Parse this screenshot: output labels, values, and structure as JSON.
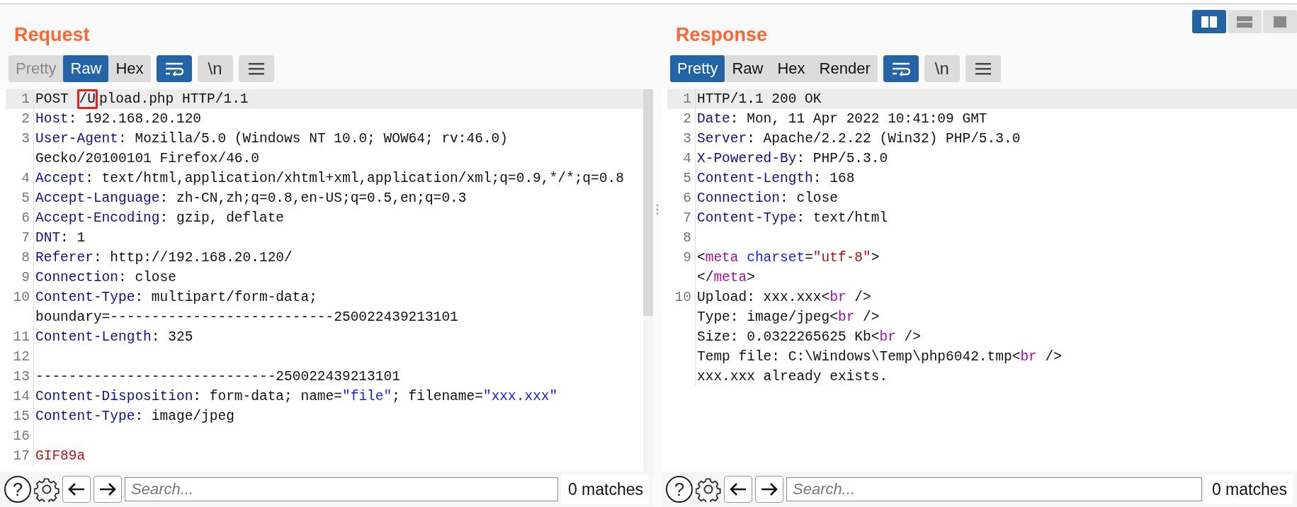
{
  "panels": [
    {
      "title": "Request",
      "tabs": [
        {
          "label": "Pretty",
          "selected": false,
          "disabled": true
        },
        {
          "label": "Raw",
          "selected": true,
          "disabled": false
        },
        {
          "label": "Hex",
          "selected": false,
          "disabled": false
        }
      ],
      "tools": [
        {
          "kind": "wrap",
          "on": true
        },
        {
          "kind": "newline",
          "label": "\\n",
          "on": false
        },
        {
          "kind": "menu",
          "on": false
        }
      ],
      "scrollbar": true,
      "lines": [
        {
          "number": "1",
          "highlighted": true,
          "rows": [
            [
              {
                "kind": "plain",
                "text": "POST "
              },
              {
                "kind": "boxed",
                "text": "/U"
              },
              {
                "kind": "plain",
                "text": "pload.php HTTP/1.1"
              }
            ]
          ]
        },
        {
          "number": "2",
          "highlighted": false,
          "rows": [
            [
              {
                "kind": "key",
                "text": "Host"
              },
              {
                "kind": "plain",
                "text": ": 192.168.20.120"
              }
            ]
          ]
        },
        {
          "number": "3",
          "highlighted": false,
          "rows": [
            [
              {
                "kind": "key",
                "text": "User-Agent"
              },
              {
                "kind": "plain",
                "text": ": Mozilla/5.0 (Windows NT 10.0; WOW64; rv:46.0)"
              }
            ],
            [
              {
                "kind": "plain",
                "text": "Gecko/20100101 Firefox/46.0"
              }
            ]
          ]
        },
        {
          "number": "4",
          "highlighted": false,
          "rows": [
            [
              {
                "kind": "key",
                "text": "Accept"
              },
              {
                "kind": "plain",
                "text": ": text/html,application/xhtml+xml,application/xml;q=0.9,*/*;q=0.8"
              }
            ]
          ]
        },
        {
          "number": "5",
          "highlighted": false,
          "rows": [
            [
              {
                "kind": "key",
                "text": "Accept-Language"
              },
              {
                "kind": "plain",
                "text": ": zh-CN,zh;q=0.8,en-US;q=0.5,en;q=0.3"
              }
            ]
          ]
        },
        {
          "number": "6",
          "highlighted": false,
          "rows": [
            [
              {
                "kind": "key",
                "text": "Accept-Encoding"
              },
              {
                "kind": "plain",
                "text": ": gzip, deflate"
              }
            ]
          ]
        },
        {
          "number": "7",
          "highlighted": false,
          "rows": [
            [
              {
                "kind": "key",
                "text": "DNT"
              },
              {
                "kind": "plain",
                "text": ": 1"
              }
            ]
          ]
        },
        {
          "number": "8",
          "highlighted": false,
          "rows": [
            [
              {
                "kind": "key",
                "text": "Referer"
              },
              {
                "kind": "plain",
                "text": ": http://192.168.20.120/"
              }
            ]
          ]
        },
        {
          "number": "9",
          "highlighted": false,
          "rows": [
            [
              {
                "kind": "key",
                "text": "Connection"
              },
              {
                "kind": "plain",
                "text": ": close"
              }
            ]
          ]
        },
        {
          "number": "10",
          "highlighted": false,
          "rows": [
            [
              {
                "kind": "key",
                "text": "Content-Type"
              },
              {
                "kind": "plain",
                "text": ": multipart/form-data;"
              }
            ],
            [
              {
                "kind": "plain",
                "text": "boundary=---------------------------250022439213101"
              }
            ]
          ]
        },
        {
          "number": "11",
          "highlighted": false,
          "rows": [
            [
              {
                "kind": "key",
                "text": "Content-Length"
              },
              {
                "kind": "plain",
                "text": ": 325"
              }
            ]
          ]
        },
        {
          "number": "12",
          "highlighted": false
        },
        {
          "number": "13",
          "highlighted": false,
          "rows": [
            [
              {
                "kind": "plain",
                "text": "-----------------------------250022439213101"
              }
            ]
          ]
        },
        {
          "number": "14",
          "highlighted": false,
          "rows": [
            [
              {
                "kind": "key",
                "text": "Content-Disposition"
              },
              {
                "kind": "plain",
                "text": ": form-data; name="
              },
              {
                "kind": "string",
                "text": "\"file\""
              },
              {
                "kind": "plain",
                "text": "; filename="
              },
              {
                "kind": "string",
                "text": "\"xxx.xxx\""
              }
            ]
          ]
        },
        {
          "number": "15",
          "highlighted": false,
          "rows": [
            [
              {
                "kind": "key",
                "text": "Content-Type"
              },
              {
                "kind": "plain",
                "text": ": image/jpeg"
              }
            ]
          ]
        },
        {
          "number": "16",
          "highlighted": false
        },
        {
          "number": "17",
          "highlighted": false,
          "rows": [
            [
              {
                "kind": "binary",
                "text": "GIF89a"
              }
            ]
          ]
        }
      ],
      "footer": {
        "help": "?",
        "search_placeholder": "Search...",
        "matches": "0 matches"
      }
    },
    {
      "title": "Response",
      "tabs": [
        {
          "label": "Pretty",
          "selected": true,
          "disabled": false
        },
        {
          "label": "Raw",
          "selected": false,
          "disabled": false
        },
        {
          "label": "Hex",
          "selected": false,
          "disabled": false
        },
        {
          "label": "Render",
          "selected": false,
          "disabled": false
        }
      ],
      "tools": [
        {
          "kind": "wrap",
          "on": true
        },
        {
          "kind": "newline",
          "label": "\\n",
          "on": false
        },
        {
          "kind": "menu",
          "on": false
        }
      ],
      "scrollbar": false,
      "lines": [
        {
          "number": "1",
          "highlighted": true,
          "rows": [
            [
              {
                "kind": "plain",
                "text": "HTTP/1.1 200 OK"
              }
            ]
          ]
        },
        {
          "number": "2",
          "highlighted": false,
          "rows": [
            [
              {
                "kind": "key",
                "text": "Date"
              },
              {
                "kind": "plain",
                "text": ": Mon, 11 Apr 2022 10:41:09 GMT"
              }
            ]
          ]
        },
        {
          "number": "3",
          "highlighted": false,
          "rows": [
            [
              {
                "kind": "key",
                "text": "Server"
              },
              {
                "kind": "plain",
                "text": ": Apache/2.2.22 (Win32) PHP/5.3.0"
              }
            ]
          ]
        },
        {
          "number": "4",
          "highlighted": false,
          "rows": [
            [
              {
                "kind": "key",
                "text": "X-Powered-By"
              },
              {
                "kind": "plain",
                "text": ": PHP/5.3.0"
              }
            ]
          ]
        },
        {
          "number": "5",
          "highlighted": false,
          "rows": [
            [
              {
                "kind": "key",
                "text": "Content-Length"
              },
              {
                "kind": "plain",
                "text": ": 168"
              }
            ]
          ]
        },
        {
          "number": "6",
          "highlighted": false,
          "rows": [
            [
              {
                "kind": "key",
                "text": "Connection"
              },
              {
                "kind": "plain",
                "text": ": close"
              }
            ]
          ]
        },
        {
          "number": "7",
          "highlighted": false,
          "rows": [
            [
              {
                "kind": "key",
                "text": "Content-Type"
              },
              {
                "kind": "plain",
                "text": ": text/html"
              }
            ]
          ]
        },
        {
          "number": "8",
          "highlighted": false
        },
        {
          "number": "9",
          "highlighted": false,
          "rows": [
            [
              {
                "kind": "plain",
                "text": "<"
              },
              {
                "kind": "tag",
                "text": "meta"
              },
              {
                "kind": "plain",
                "text": " "
              },
              {
                "kind": "attr",
                "text": "charset"
              },
              {
                "kind": "plain",
                "text": "="
              },
              {
                "kind": "attr_value",
                "text": "\"utf-8\""
              },
              {
                "kind": "plain",
                "text": ">"
              }
            ],
            [
              {
                "kind": "plain",
                "text": "</"
              },
              {
                "kind": "tag",
                "text": "meta"
              },
              {
                "kind": "plain",
                "text": ">"
              }
            ]
          ]
        },
        {
          "number": "10",
          "highlighted": false,
          "rows": [
            [
              {
                "kind": "plain",
                "text": "Upload: xxx.xxx<"
              },
              {
                "kind": "tag",
                "text": "br"
              },
              {
                "kind": "plain",
                "text": " />"
              }
            ],
            [
              {
                "kind": "plain",
                "text": "Type: image/jpeg<"
              },
              {
                "kind": "tag",
                "text": "br"
              },
              {
                "kind": "plain",
                "text": " />"
              }
            ],
            [
              {
                "kind": "plain",
                "text": "Size: 0.0322265625 Kb<"
              },
              {
                "kind": "tag",
                "text": "br"
              },
              {
                "kind": "plain",
                "text": " />"
              }
            ],
            [
              {
                "kind": "plain",
                "text": "Temp file: C:\\Windows\\Temp\\php6042.tmp<"
              },
              {
                "kind": "tag",
                "text": "br"
              },
              {
                "kind": "plain",
                "text": " />"
              }
            ],
            [
              {
                "kind": "plain",
                "text": "xxx.xxx already exists."
              }
            ]
          ]
        }
      ],
      "footer": {
        "help": "?",
        "search_placeholder": "Search...",
        "matches": "0 matches"
      }
    }
  ],
  "layout_buttons": [
    {
      "kind": "split",
      "selected": true
    },
    {
      "kind": "stacked",
      "selected": false
    },
    {
      "kind": "single",
      "selected": false
    }
  ]
}
